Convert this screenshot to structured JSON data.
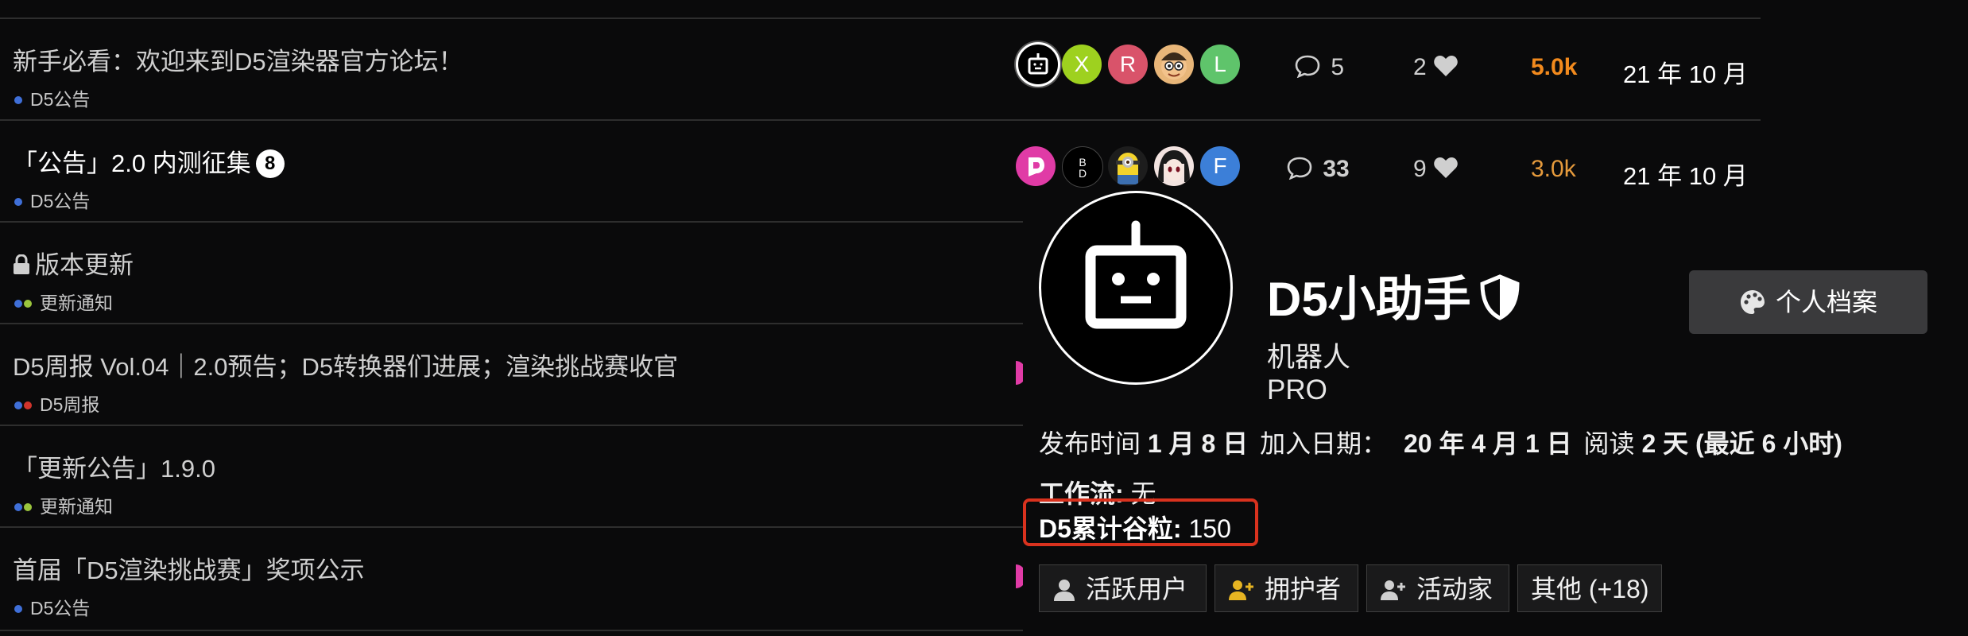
{
  "topics": [
    {
      "title": "新手必看：欢迎来到D5渲染器官方论坛！",
      "category": "D5公告",
      "category_colors": [
        "#3f6fd8"
      ],
      "posters": [
        {
          "kind": "robot",
          "color": "#000000"
        },
        {
          "letter": "X",
          "color": "#9ed11f"
        },
        {
          "letter": "R",
          "color": "#d9536a"
        },
        {
          "kind": "cartoon",
          "color": "#e8b679"
        },
        {
          "letter": "L",
          "color": "#5fc46b"
        }
      ],
      "replies": "5",
      "likes": "2",
      "views": "5.0k",
      "views_color": "#f28a1d",
      "activity": "21 年 10 月"
    },
    {
      "title": "「公告」2.0 内测征集",
      "badge": "8",
      "category": "D5公告",
      "category_colors": [
        "#3f6fd8"
      ],
      "posters": [
        {
          "letter": "D",
          "color": "#e03ba6"
        },
        {
          "kind": "logo",
          "color": "#000000"
        },
        {
          "kind": "minion",
          "color": "#c9a23a"
        },
        {
          "kind": "anime",
          "color": "#f2e3e0"
        },
        {
          "letter": "F",
          "color": "#3c7fd8"
        }
      ],
      "replies": "33",
      "likes": "9",
      "views": "3.0k",
      "views_color": "#e59a3c",
      "activity": "21 年 10 月"
    },
    {
      "title": "版本更新",
      "locked": true,
      "category": "更新通知",
      "category_colors": [
        "#3f6fd8",
        "#9bc53d"
      ]
    },
    {
      "title": "D5周报 Vol.04｜2.0预告；D5转换器们进展；渲染挑战赛收官",
      "category": "D5周报",
      "category_colors": [
        "#3f6fd8",
        "#d0342c"
      ]
    },
    {
      "title": "「更新公告」1.9.0",
      "category": "更新通知",
      "category_colors": [
        "#3f6fd8",
        "#9bc53d"
      ]
    },
    {
      "title": "首届「D5渲染挑战赛」奖项公示",
      "category": "D5公告",
      "category_colors": [
        "#3f6fd8"
      ]
    }
  ],
  "user_card": {
    "avatar_icon": "robot-icon",
    "name": "D5小助手",
    "name_badge_icon": "shield-icon",
    "title": "机器人",
    "group": "PRO",
    "profile_button": "个人档案",
    "posted_label": "发布时间",
    "posted_value": "1 月 8 日",
    "joined_label": "加入日期：",
    "joined_value": "20 年 4 月 1 日",
    "read_label": "阅读",
    "read_value": "2 天 (最近 6 小时)",
    "workflow_label": "工作流:",
    "workflow_value": "无",
    "points_label": "D5累计谷粒:",
    "points_value": "150",
    "groups": [
      {
        "label": "活跃用户",
        "icon": "user-icon",
        "icon_color": "#cfcfcf"
      },
      {
        "label": "拥护者",
        "icon": "user-plus-icon",
        "icon_color": "#e6b422"
      },
      {
        "label": "活动家",
        "icon": "user-plus-icon",
        "icon_color": "#cfcfcf"
      },
      {
        "label": "其他 (+18)"
      }
    ],
    "highlight_color": "#d9321e"
  }
}
